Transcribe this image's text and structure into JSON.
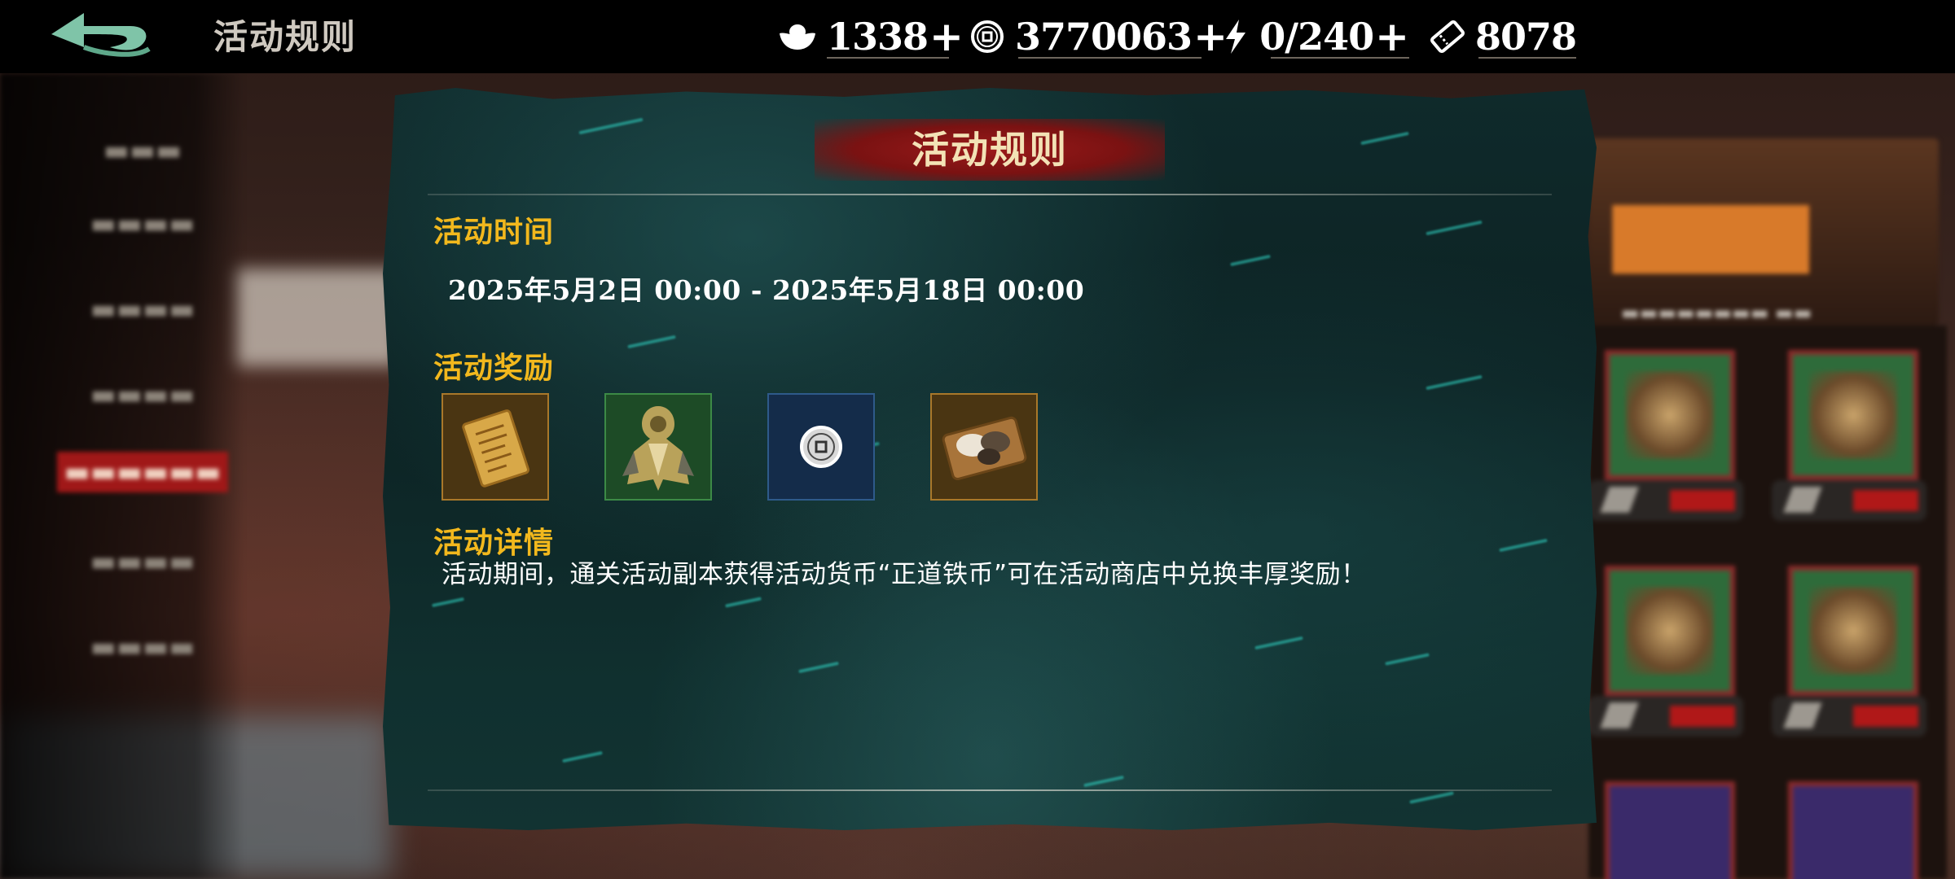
{
  "header": {
    "title": "活动规则",
    "back_icon": "back-arrow-icon"
  },
  "currencies": [
    {
      "name": "silver-ingot",
      "icon": "silver-ingot-icon",
      "value": "1338"
    },
    {
      "name": "copper-coin",
      "icon": "coin-icon",
      "value": "3770063"
    },
    {
      "name": "stamina",
      "icon": "lightning-icon",
      "value": "0/240"
    },
    {
      "name": "ticket",
      "icon": "ticket-icon",
      "value": "8078"
    }
  ],
  "panel": {
    "title": "活动规则",
    "time_heading": "活动时间",
    "time_value": "2025年5月2日 00:00 - 2025年5月18日 00:00",
    "rewards_heading": "活动奖励",
    "rewards": [
      {
        "icon": "scroll-icon",
        "frame": "gold"
      },
      {
        "icon": "warrior-figure-icon",
        "frame": "green"
      },
      {
        "icon": "coin-icon",
        "frame": "blue"
      },
      {
        "icon": "mushroom-plate-icon",
        "frame": "gold"
      }
    ],
    "details_heading": "活动详情",
    "details_text": "活动期间，通关活动副本获得活动货币“正道铁币”可在活动商店中兑换丰厚奖励！"
  },
  "colors": {
    "heading": "#f2b81d",
    "title_banner": "#9b1a1a",
    "panel_bg": "#0f2a2b"
  }
}
